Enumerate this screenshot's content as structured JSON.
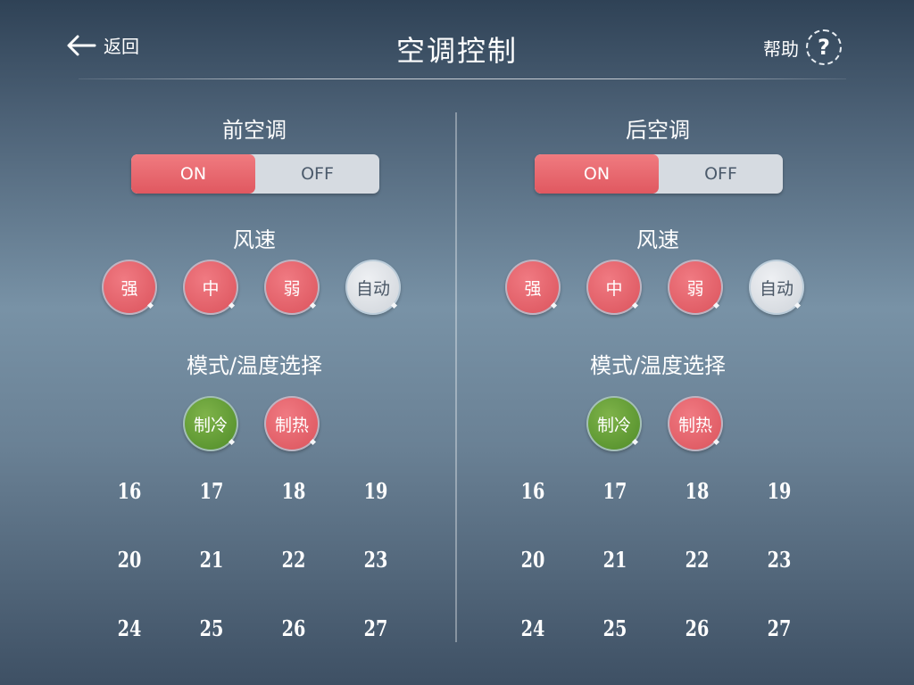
{
  "header": {
    "back_label": "返回",
    "title": "空调控制",
    "help_label": "帮助",
    "help_glyph": "?"
  },
  "panels": [
    {
      "title": "前空调",
      "power": {
        "on_label": "ON",
        "off_label": "OFF",
        "selected": "ON"
      },
      "speed_label": "风速",
      "speeds": [
        "强",
        "中",
        "弱",
        "自动"
      ],
      "mode_label": "模式/温度选择",
      "modes": [
        "制冷",
        "制热"
      ],
      "temps": [
        "16",
        "17",
        "18",
        "19",
        "20",
        "21",
        "22",
        "23",
        "24",
        "25",
        "26",
        "27"
      ]
    },
    {
      "title": "后空调",
      "power": {
        "on_label": "ON",
        "off_label": "OFF",
        "selected": "ON"
      },
      "speed_label": "风速",
      "speeds": [
        "强",
        "中",
        "弱",
        "自动"
      ],
      "mode_label": "模式/温度选择",
      "modes": [
        "制冷",
        "制热"
      ],
      "temps": [
        "16",
        "17",
        "18",
        "19",
        "20",
        "21",
        "22",
        "23",
        "24",
        "25",
        "26",
        "27"
      ]
    }
  ],
  "colors": {
    "active_red": "#e05860",
    "cool_green": "#4f8c28",
    "inactive_grey": "#d6dbe1"
  }
}
